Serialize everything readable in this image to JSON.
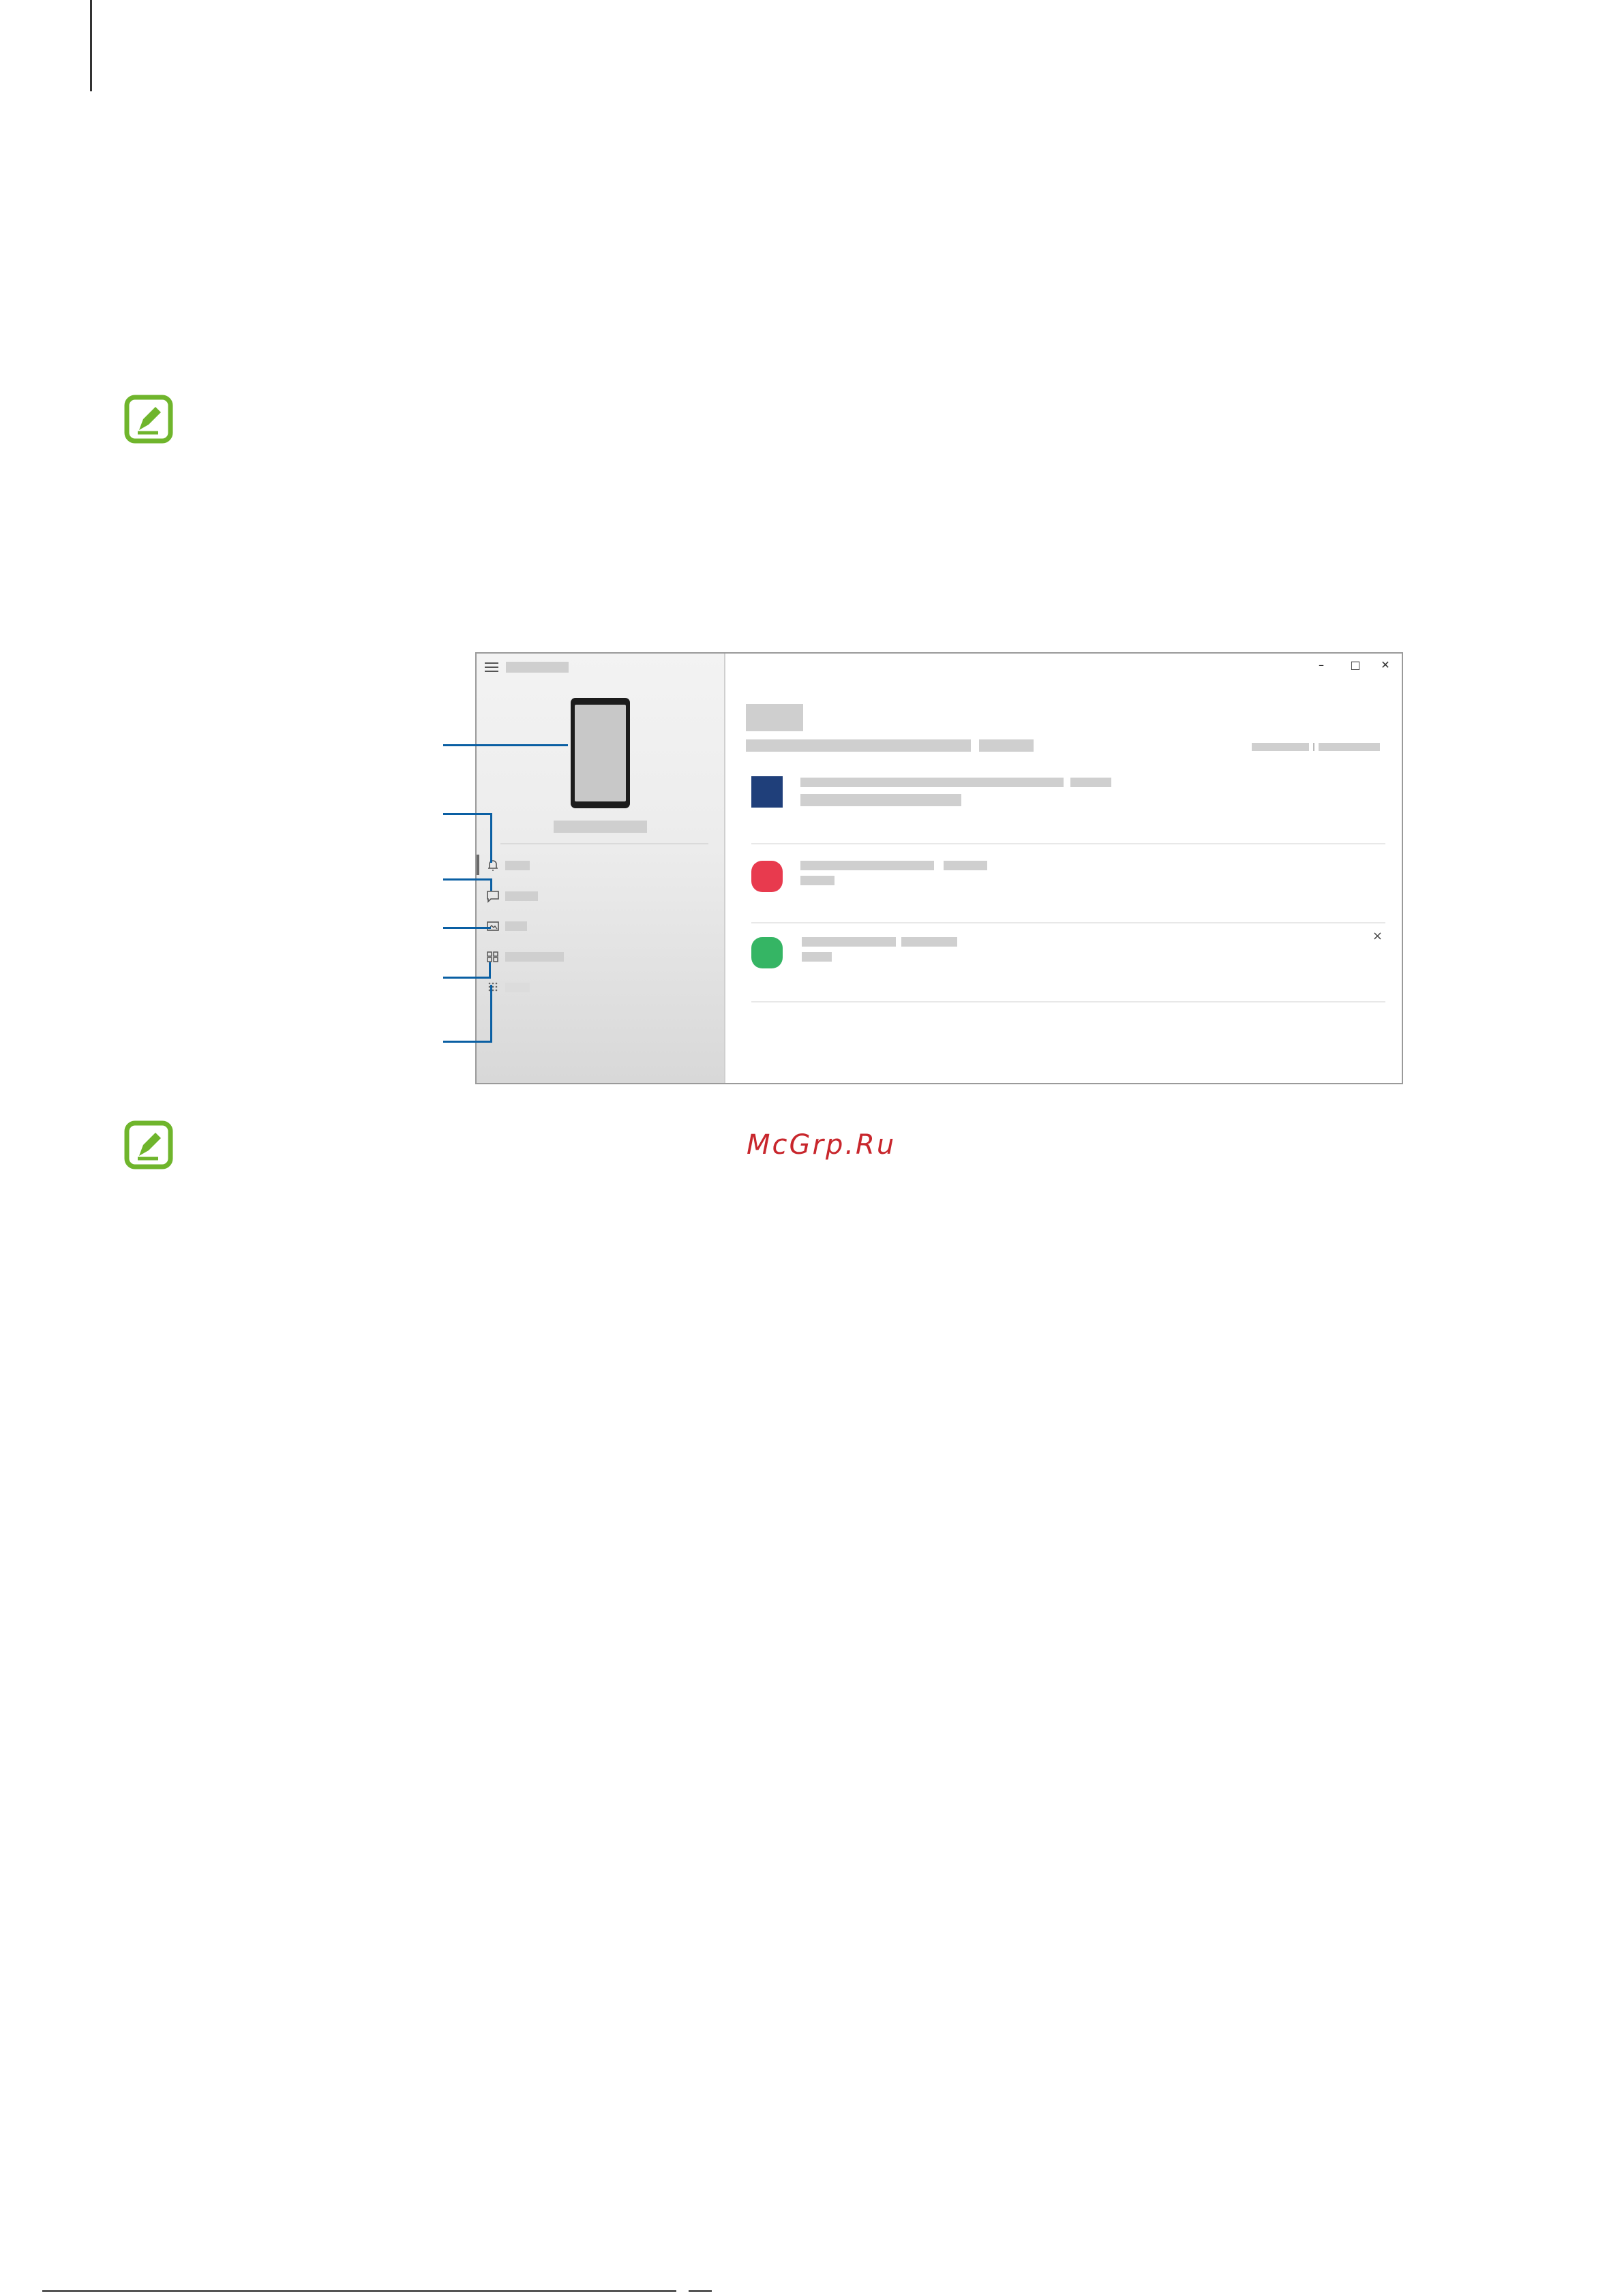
{
  "watermark": {
    "text": "McGrp.Ru"
  },
  "note_icons": [
    {
      "name": "note-icon",
      "color": "#6fb52c"
    },
    {
      "name": "note-icon",
      "color": "#6fb52c"
    }
  ],
  "window": {
    "controls": {
      "minimize": "–",
      "maximize": "□",
      "close": "✕"
    },
    "notifications": [
      {
        "icon_color": "#1f3f7a",
        "shape": "square"
      },
      {
        "icon_color": "#e83a4e",
        "shape": "rounded"
      },
      {
        "icon_color": "#35b564",
        "shape": "rounded",
        "dismiss": "×"
      }
    ]
  },
  "callout_color": "#0a5fa3"
}
